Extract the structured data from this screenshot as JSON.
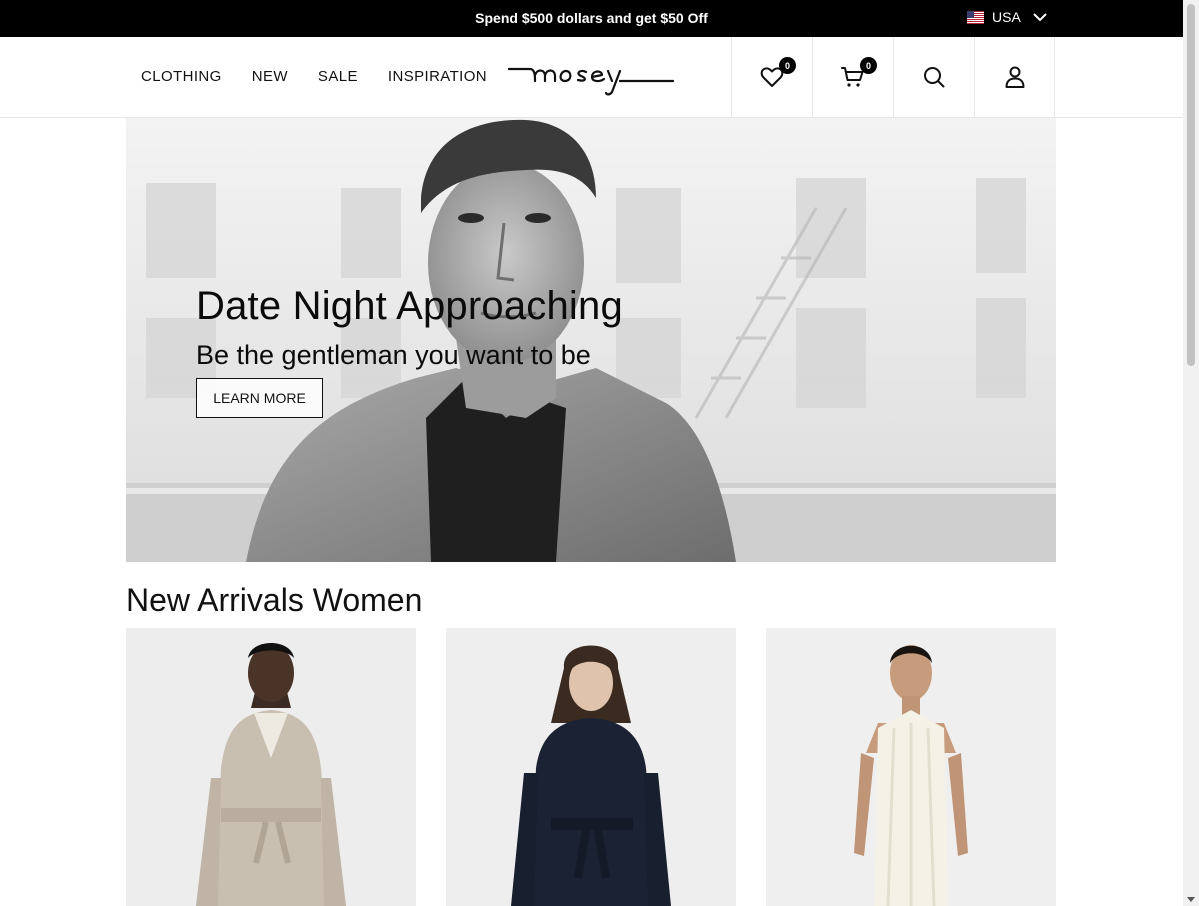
{
  "promo": {
    "text": "Spend $500 dollars and get $50 Off"
  },
  "locale": {
    "country": "USA",
    "flag_icon": "us-flag-icon"
  },
  "nav": {
    "items": [
      "CLOTHING",
      "NEW",
      "SALE",
      "INSPIRATION"
    ]
  },
  "brand": {
    "name": "mosey"
  },
  "header_icons": {
    "wishlist": {
      "icon": "heart-icon",
      "count": "0"
    },
    "cart": {
      "icon": "cart-icon",
      "count": "0"
    },
    "search": {
      "icon": "search-icon"
    },
    "account": {
      "icon": "user-icon"
    }
  },
  "hero": {
    "title": "Date Night Approaching",
    "subtitle": "Be the gentleman you want to be",
    "cta": "LEARN MORE"
  },
  "new_arrivals": {
    "title": "New Arrivals Women",
    "products": [
      {
        "image": "beige-trench-coat-photo"
      },
      {
        "image": "navy-wool-coat-photo"
      },
      {
        "image": "white-halter-dress-photo"
      }
    ]
  },
  "colors": {
    "promo_bg": "#000000",
    "accent": "#111111",
    "border": "#e6e6e6"
  }
}
